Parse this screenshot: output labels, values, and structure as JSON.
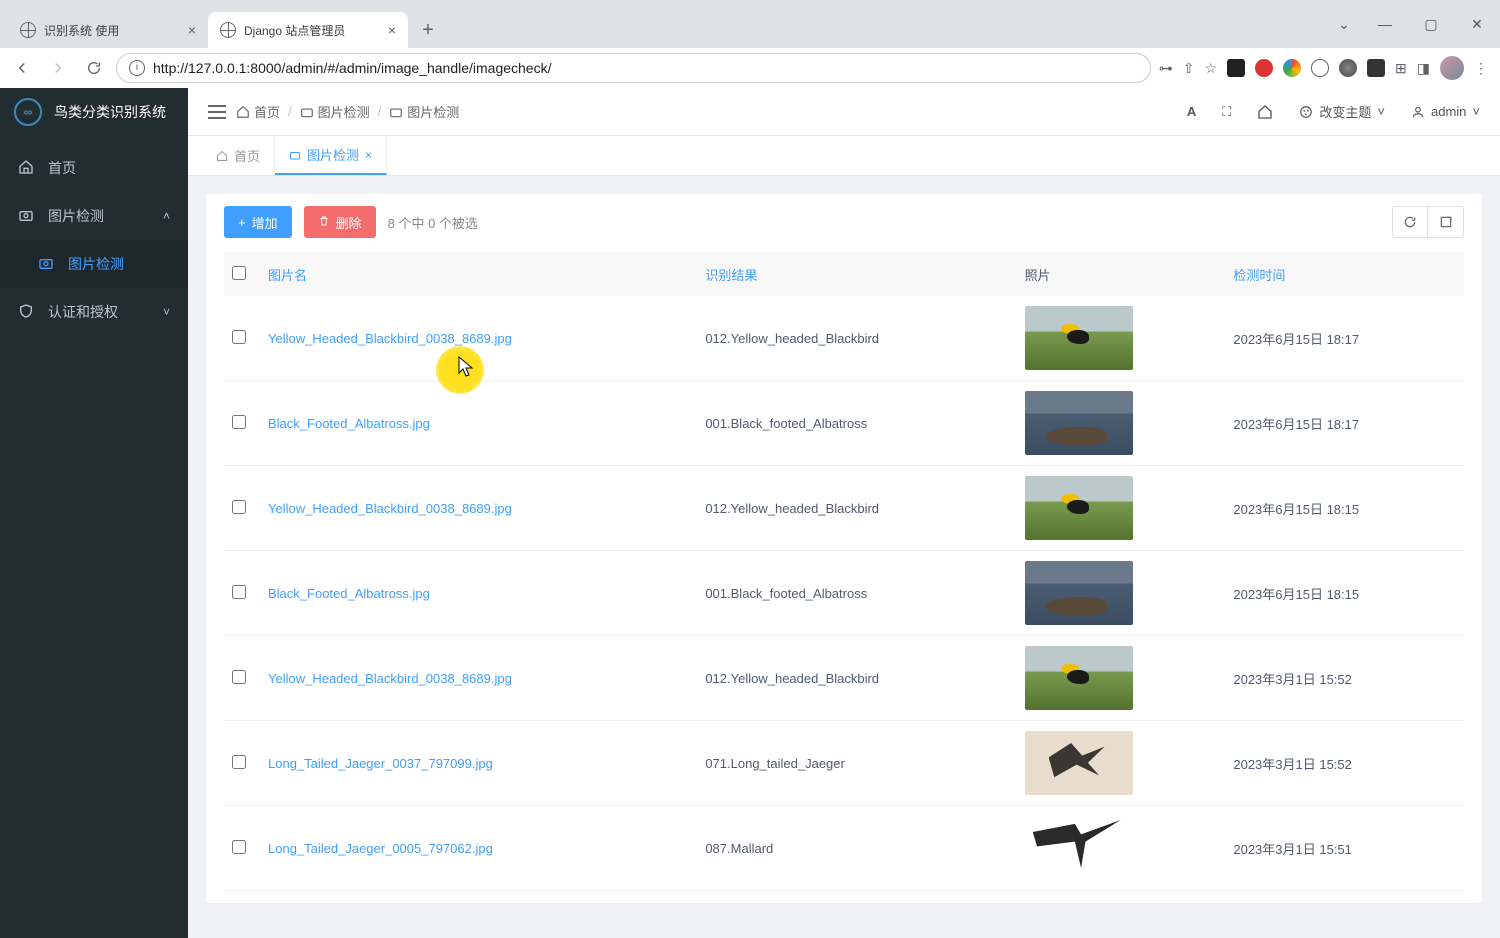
{
  "browser": {
    "tabs": [
      {
        "title": "识别系统 使用",
        "active": false
      },
      {
        "title": "Django 站点管理员",
        "active": true
      }
    ],
    "url": "http://127.0.0.1:8000/admin/#/admin/image_handle/imagecheck/"
  },
  "sidebar": {
    "app_title": "鸟类分类识别系统",
    "logo_text": "∞",
    "items": [
      {
        "label": "首页",
        "icon": "home"
      },
      {
        "label": "图片检测",
        "icon": "camera",
        "expandable": true
      },
      {
        "label": "图片检测",
        "icon": "camera",
        "level": 2,
        "active": true
      },
      {
        "label": "认证和授权",
        "icon": "shield",
        "expandable": true
      }
    ]
  },
  "topbar": {
    "breadcrumb": [
      "首页",
      "图片检测",
      "图片检测"
    ],
    "theme_label": "改变主题",
    "user_label": "admin"
  },
  "tabs_bar": {
    "tabs": [
      {
        "label": "首页",
        "icon": "home",
        "closable": false
      },
      {
        "label": "图片检测",
        "icon": "camera",
        "closable": true,
        "active": true
      }
    ]
  },
  "list": {
    "btn_add": "增加",
    "btn_del": "删除",
    "selection_text": "8 个中 0 个被选",
    "columns": {
      "filename": "图片名",
      "result": "识别结果",
      "photo": "照片",
      "time": "检测时间"
    },
    "rows": [
      {
        "filename": "Yellow_Headed_Blackbird_0038_8689.jpg",
        "result": "012.Yellow_headed_Blackbird",
        "thumb": "blackbird",
        "time": "2023年6月15日 18:17"
      },
      {
        "filename": "Black_Footed_Albatross.jpg",
        "result": "001.Black_footed_Albatross",
        "thumb": "albatross",
        "time": "2023年6月15日 18:17"
      },
      {
        "filename": "Yellow_Headed_Blackbird_0038_8689.jpg",
        "result": "012.Yellow_headed_Blackbird",
        "thumb": "blackbird",
        "time": "2023年6月15日 18:15"
      },
      {
        "filename": "Black_Footed_Albatross.jpg",
        "result": "001.Black_footed_Albatross",
        "thumb": "albatross",
        "time": "2023年6月15日 18:15"
      },
      {
        "filename": "Yellow_Headed_Blackbird_0038_8689.jpg",
        "result": "012.Yellow_headed_Blackbird",
        "thumb": "blackbird",
        "time": "2023年3月1日 15:52"
      },
      {
        "filename": "Long_Tailed_Jaeger_0037_797099.jpg",
        "result": "071.Long_tailed_Jaeger",
        "thumb": "jaeger1",
        "time": "2023年3月1日 15:52"
      },
      {
        "filename": "Long_Tailed_Jaeger_0005_797062.jpg",
        "result": "087.Mallard",
        "thumb": "jaeger2",
        "time": "2023年3月1日 15:51"
      }
    ]
  }
}
